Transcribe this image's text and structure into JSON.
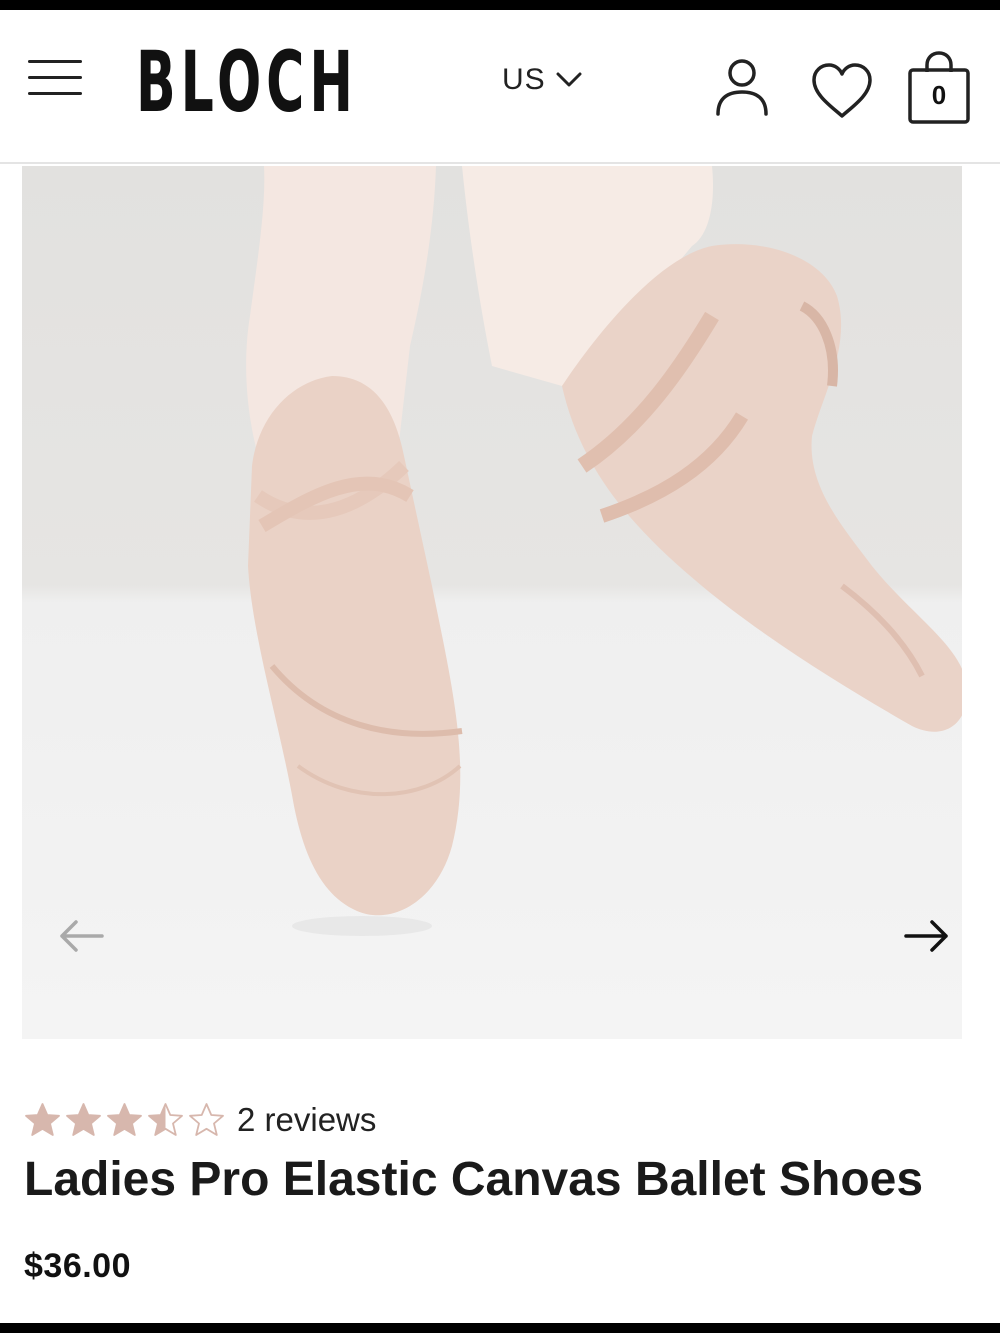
{
  "header": {
    "brand": "BLOCH",
    "region": "US",
    "cart_count": "0"
  },
  "product": {
    "rating_value": 3.5,
    "rating_max": 5,
    "star_color": "#d7b7ad",
    "reviews_label": "2 reviews",
    "title": "Ladies Pro Elastic Canvas Ballet Shoes",
    "price": "$36.00"
  },
  "icons": [
    "menu-icon",
    "chevron-down-icon",
    "account-icon",
    "heart-icon",
    "bag-icon",
    "arrow-left-icon",
    "arrow-right-icon",
    "star-icon"
  ]
}
